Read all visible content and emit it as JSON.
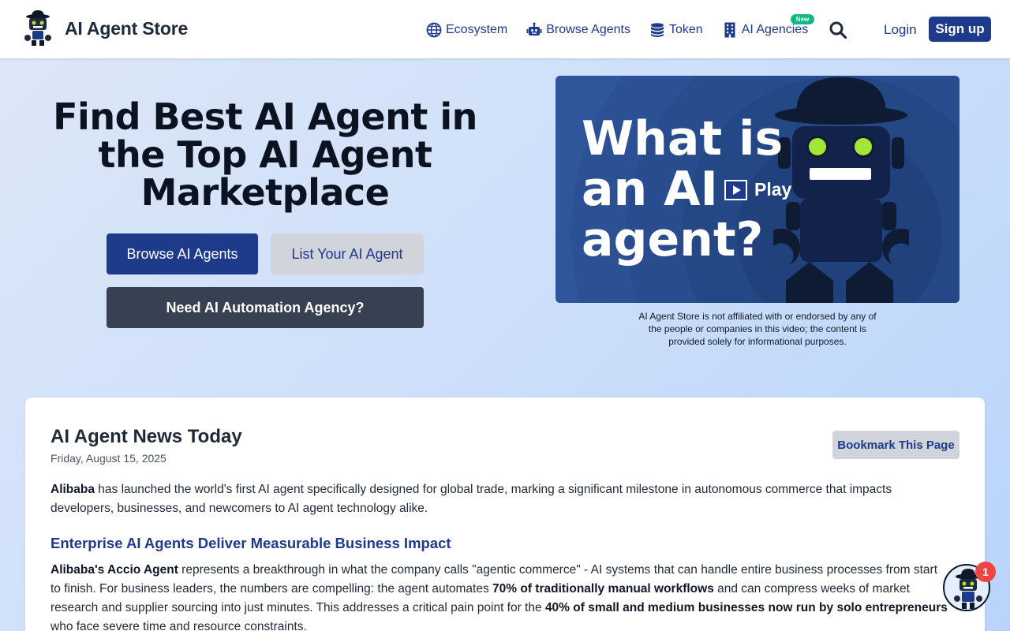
{
  "header": {
    "brand_name": "AI Agent Store",
    "nav": [
      {
        "label": "Ecosystem",
        "icon": "globe-icon"
      },
      {
        "label": "Browse Agents",
        "icon": "robot-icon"
      },
      {
        "label": "Token",
        "icon": "coins-icon"
      },
      {
        "label": "AI Agencies",
        "icon": "building-icon",
        "badge": "New"
      }
    ],
    "login_label": "Login",
    "signup_label": "Sign up"
  },
  "hero": {
    "title": "Find Best AI Agent in the Top AI Agent Marketplace",
    "browse_label": "Browse AI Agents",
    "list_label": "List Your AI Agent",
    "agency_label": "Need AI Automation Agency?"
  },
  "video": {
    "title": "What is an AI agent?",
    "play_label": "Play",
    "disclaimer": "AI Agent Store is not affiliated with or endorsed by any of the people or companies in this video; the content is provided solely for informational purposes."
  },
  "news": {
    "title": "AI Agent News Today",
    "date": "Friday, August 15, 2025",
    "bookmark_label": "Bookmark This Page",
    "p1": {
      "bold": "Alibaba",
      "rest": " has launched the world's first AI agent specifically designed for global trade, marking a significant milestone in autonomous commerce that impacts developers, businesses, and newcomers to AI agent technology alike."
    },
    "subheading": "Enterprise AI Agents Deliver Measurable Business Impact",
    "p2": {
      "b1": "Alibaba's Accio Agent",
      "t1": " represents a breakthrough in what the company calls \"agentic commerce\" - AI systems that can handle entire business processes from start to finish. For business leaders, the numbers are compelling: the agent automates ",
      "b2": "70% of traditionally manual workflows",
      "t2": " and can compress weeks of market research and supplier sourcing into just minutes. This addresses a critical pain point for the ",
      "b3": "40% of small and medium businesses now run by solo entrepreneurs",
      "t3": " who face severe time and resource constraints."
    }
  },
  "chat": {
    "badge_count": "1"
  },
  "colors": {
    "brand_navy": "#1e3a8a",
    "dark_gray": "#374151",
    "light_gray": "#d1d5db",
    "badge_green": "#10b981",
    "badge_red": "#ef4444",
    "video_bg": "#2f569a"
  }
}
